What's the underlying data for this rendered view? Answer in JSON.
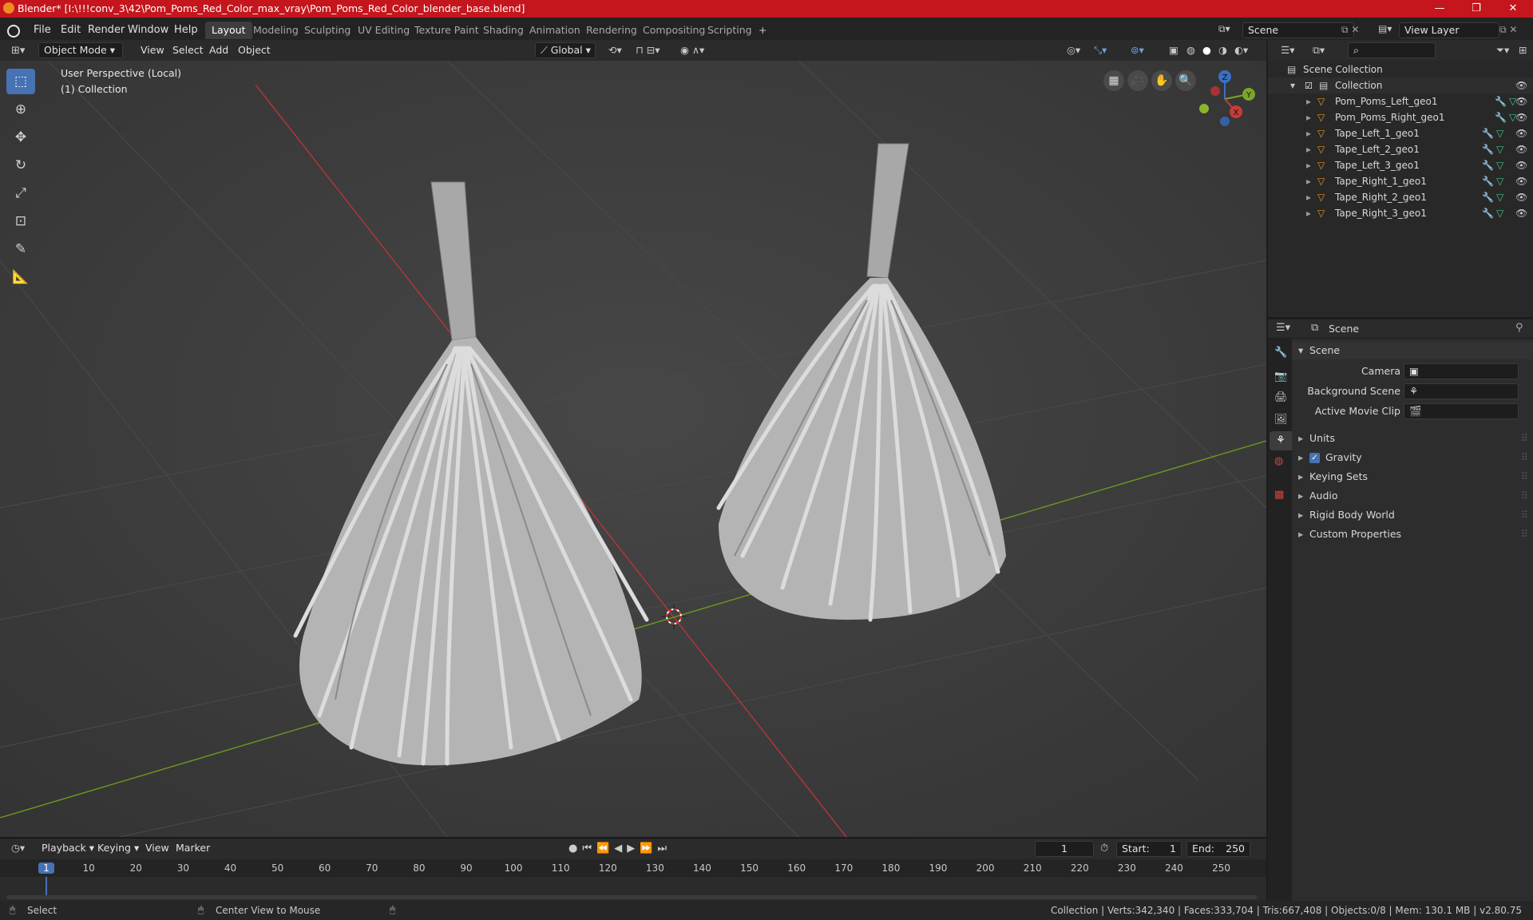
{
  "window": {
    "title": "Blender* [I:\\!!!conv_3\\42\\Pom_Poms_Red_Color_max_vray\\Pom_Poms_Red_Color_blender_base.blend]",
    "minimize": "—",
    "maximize": "❐",
    "close": "✕"
  },
  "menu": [
    "File",
    "Edit",
    "Render",
    "Window",
    "Help"
  ],
  "workspaces": [
    "Layout",
    "Modeling",
    "Sculpting",
    "UV Editing",
    "Texture Paint",
    "Shading",
    "Animation",
    "Rendering",
    "Compositing",
    "Scripting"
  ],
  "workspace_add": "+",
  "scene_field": "Scene",
  "view_layer_field": "View Layer",
  "viewport_header": {
    "mode": "Object Mode",
    "menus": [
      "View",
      "Select",
      "Add",
      "Object"
    ],
    "transform": "Global"
  },
  "viewport": {
    "perspective": "User Perspective (Local)",
    "collection": "(1) Collection",
    "gizmo": {
      "x": "X",
      "y": "Y",
      "z": "Z"
    }
  },
  "outliner": {
    "search_placeholder": "",
    "root": "Scene Collection",
    "collection": "Collection",
    "objects": [
      "Pom_Poms_Left_geo1",
      "Pom_Poms_Right_geo1",
      "Tape_Left_1_geo1",
      "Tape_Left_2_geo1",
      "Tape_Left_3_geo1",
      "Tape_Right_1_geo1",
      "Tape_Right_2_geo1",
      "Tape_Right_3_geo1"
    ]
  },
  "properties": {
    "header": "Scene",
    "panel": "Scene",
    "fields": [
      {
        "label": "Camera",
        "value": ""
      },
      {
        "label": "Background Scene",
        "value": ""
      },
      {
        "label": "Active Movie Clip",
        "value": ""
      }
    ],
    "sections": [
      "Units",
      "Gravity",
      "Keying Sets",
      "Audio",
      "Rigid Body World",
      "Custom Properties"
    ],
    "gravity_checked": true
  },
  "timeline": {
    "menus": [
      "Playback",
      "Keying",
      "View",
      "Marker"
    ],
    "current_frame": "1",
    "start_label": "Start:",
    "start": "1",
    "end_label": "End:",
    "end": "250",
    "ticks": [
      "1",
      "10",
      "20",
      "30",
      "40",
      "50",
      "60",
      "70",
      "80",
      "90",
      "100",
      "110",
      "120",
      "130",
      "140",
      "150",
      "160",
      "170",
      "180",
      "190",
      "200",
      "210",
      "220",
      "230",
      "240",
      "250"
    ]
  },
  "status": {
    "left": "Select",
    "middle": "Center View to Mouse",
    "right": "Collection | Verts:342,340 | Faces:333,704 | Tris:667,408 | Objects:0/8 | Mem: 130.1 MB | v2.80.75"
  },
  "colors": {
    "accent": "#4772b3",
    "titlebar": "#c4161c",
    "x_axis": "#c0392b",
    "y_axis": "#6d9a1e"
  }
}
